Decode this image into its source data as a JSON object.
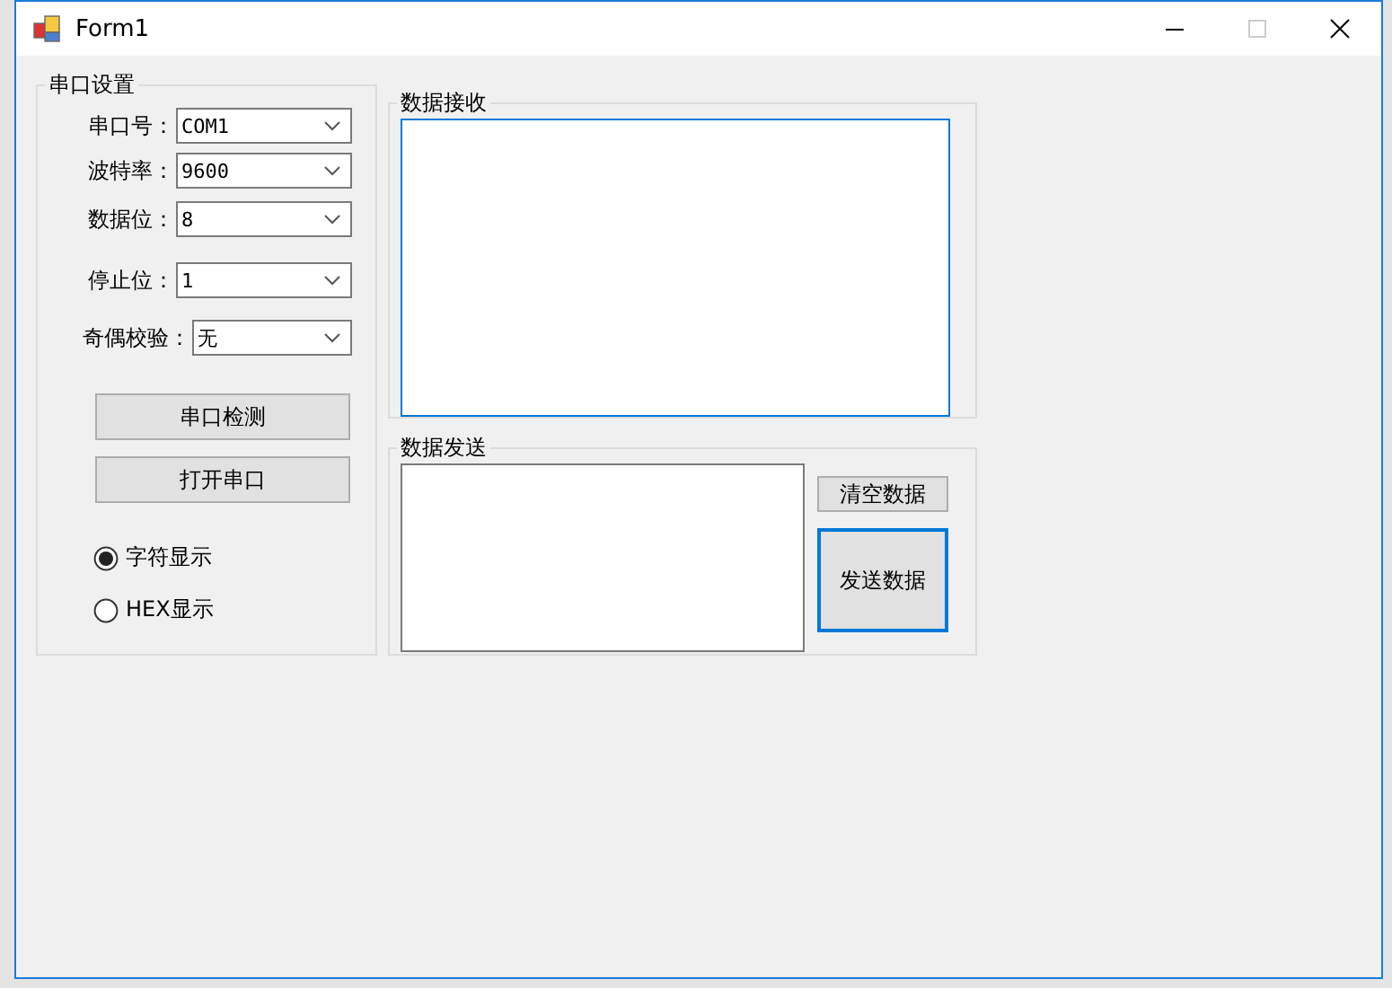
{
  "window": {
    "title": "Form1",
    "maximize_enabled": false
  },
  "serial_settings": {
    "title": "串口设置",
    "fields": [
      {
        "label": "串口号：",
        "value": "COM1"
      },
      {
        "label": "波特率：",
        "value": "9600"
      },
      {
        "label": "数据位：",
        "value": "8"
      },
      {
        "label": "停止位：",
        "value": "1"
      },
      {
        "label": "奇偶校验：",
        "value": "无"
      }
    ],
    "buttons": [
      "串口检测",
      "打开串口"
    ],
    "display_mode": [
      {
        "label": "字符显示",
        "selected": true
      },
      {
        "label": "HEX显示",
        "selected": false
      }
    ]
  },
  "receive": {
    "title": "数据接收",
    "focused": true
  },
  "send": {
    "title": "数据发送",
    "buttons": [
      {
        "label": "清空数据",
        "default": false
      },
      {
        "label": "发送数据",
        "default": true
      }
    ]
  }
}
